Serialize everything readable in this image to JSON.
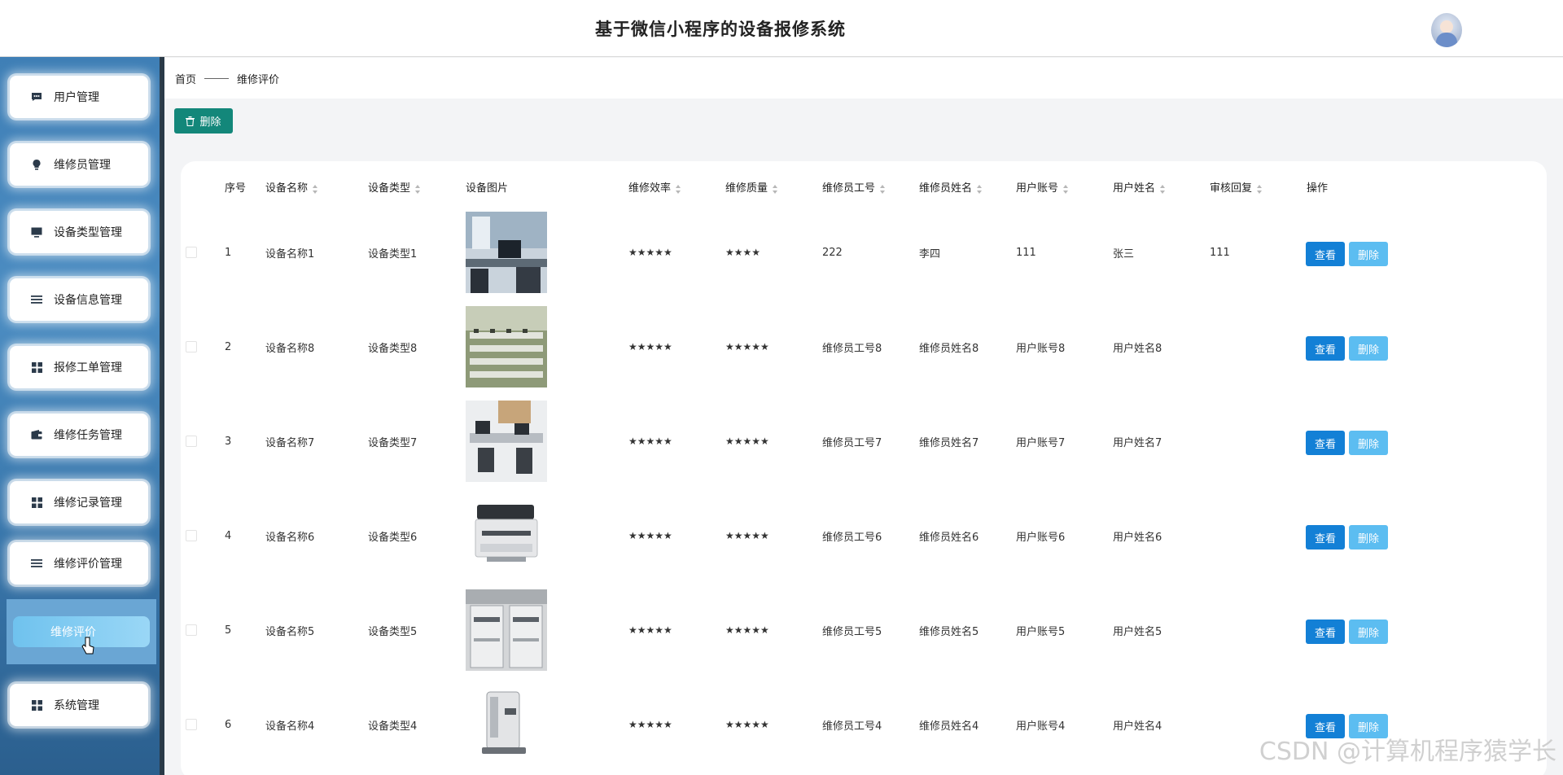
{
  "header": {
    "title": "基于微信小程序的设备报修系统"
  },
  "sidebar": {
    "items": [
      {
        "label": "用户管理",
        "icon": "chat-icon"
      },
      {
        "label": "维修员管理",
        "icon": "bulb-icon"
      },
      {
        "label": "设备类型管理",
        "icon": "monitor-icon"
      },
      {
        "label": "设备信息管理",
        "icon": "list-icon"
      },
      {
        "label": "报修工单管理",
        "icon": "grid-icon"
      },
      {
        "label": "维修任务管理",
        "icon": "wallet-icon"
      },
      {
        "label": "维修记录管理",
        "icon": "grid-icon"
      },
      {
        "label": "维修评价管理",
        "icon": "list-icon"
      },
      {
        "label": "系统管理",
        "icon": "grid-icon"
      }
    ],
    "active_sub": "维修评价"
  },
  "breadcrumb": {
    "home": "首页",
    "current": "维修评价"
  },
  "toolbar": {
    "delete_label": "删除"
  },
  "table": {
    "headers": [
      "序号",
      "设备名称",
      "设备类型",
      "设备图片",
      "维修效率",
      "维修质量",
      "维修员工号",
      "维修员姓名",
      "用户账号",
      "用户姓名",
      "审核回复",
      "操作"
    ],
    "view_label": "查看",
    "delete_label": "删除",
    "rows": [
      {
        "no": "1",
        "name": "设备名称1",
        "type": "设备类型1",
        "efficiency": "★★★★★",
        "quality": "★★★★",
        "worker_no": "222",
        "worker_name": "李四",
        "account": "111",
        "user_name": "张三",
        "reply": "111"
      },
      {
        "no": "2",
        "name": "设备名称8",
        "type": "设备类型8",
        "efficiency": "★★★★★",
        "quality": "★★★★★",
        "worker_no": "维修员工号8",
        "worker_name": "维修员姓名8",
        "account": "用户账号8",
        "user_name": "用户姓名8",
        "reply": ""
      },
      {
        "no": "3",
        "name": "设备名称7",
        "type": "设备类型7",
        "efficiency": "★★★★★",
        "quality": "★★★★★",
        "worker_no": "维修员工号7",
        "worker_name": "维修员姓名7",
        "account": "用户账号7",
        "user_name": "用户姓名7",
        "reply": ""
      },
      {
        "no": "4",
        "name": "设备名称6",
        "type": "设备类型6",
        "efficiency": "★★★★★",
        "quality": "★★★★★",
        "worker_no": "维修员工号6",
        "worker_name": "维修员姓名6",
        "account": "用户账号6",
        "user_name": "用户姓名6",
        "reply": ""
      },
      {
        "no": "5",
        "name": "设备名称5",
        "type": "设备类型5",
        "efficiency": "★★★★★",
        "quality": "★★★★★",
        "worker_no": "维修员工号5",
        "worker_name": "维修员姓名5",
        "account": "用户账号5",
        "user_name": "用户姓名5",
        "reply": ""
      },
      {
        "no": "6",
        "name": "设备名称4",
        "type": "设备类型4",
        "efficiency": "★★★★★",
        "quality": "★★★★★",
        "worker_no": "维修员工号4",
        "worker_name": "维修员姓名4",
        "account": "用户账号4",
        "user_name": "用户姓名4",
        "reply": ""
      }
    ]
  },
  "watermark": "CSDN @计算机程序猿学长",
  "colors": {
    "primary": "#1380d6",
    "danger_light": "#5cbdf1",
    "teal": "#13877a",
    "sidebar": "#3f7fb6"
  }
}
